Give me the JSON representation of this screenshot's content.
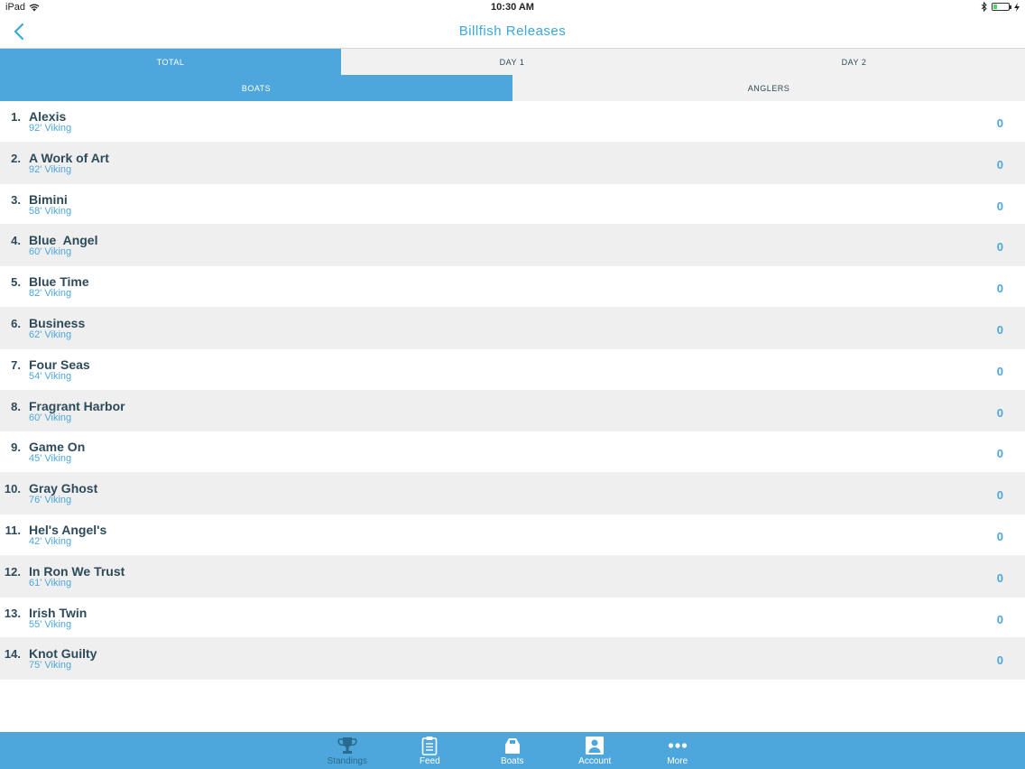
{
  "status_bar": {
    "device": "iPad",
    "time": "10:30 AM"
  },
  "nav": {
    "title": "Billfish Releases"
  },
  "day_tabs": [
    {
      "label": "TOTAL",
      "active": true
    },
    {
      "label": "DAY 1",
      "active": false
    },
    {
      "label": "DAY 2",
      "active": false
    }
  ],
  "kind_tabs": [
    {
      "label": "BOATS",
      "active": true
    },
    {
      "label": "ANGLERS",
      "active": false
    }
  ],
  "rows": [
    {
      "rank": "1.",
      "name": "Alexis",
      "sub": "92' Viking",
      "score": "0"
    },
    {
      "rank": "2.",
      "name": "A Work of Art",
      "sub": "92' Viking",
      "score": "0"
    },
    {
      "rank": "3.",
      "name": "Bimini",
      "sub": "58' Viking",
      "score": "0"
    },
    {
      "rank": "4.",
      "name": "Blue  Angel",
      "sub": "60' Viking",
      "score": "0"
    },
    {
      "rank": "5.",
      "name": "Blue Time",
      "sub": "82' Viking",
      "score": "0"
    },
    {
      "rank": "6.",
      "name": "Business",
      "sub": "62' Viking",
      "score": "0"
    },
    {
      "rank": "7.",
      "name": "Four Seas",
      "sub": "54' Viking",
      "score": "0"
    },
    {
      "rank": "8.",
      "name": "Fragrant Harbor",
      "sub": "60' Viking",
      "score": "0"
    },
    {
      "rank": "9.",
      "name": "Game On",
      "sub": "45' Viking",
      "score": "0"
    },
    {
      "rank": "10.",
      "name": "Gray Ghost",
      "sub": "76' Viking",
      "score": "0"
    },
    {
      "rank": "11.",
      "name": "Hel's Angel's",
      "sub": "42' Viking",
      "score": "0"
    },
    {
      "rank": "12.",
      "name": "In Ron We Trust",
      "sub": "61' Viking",
      "score": "0"
    },
    {
      "rank": "13.",
      "name": "Irish Twin",
      "sub": "55' Viking",
      "score": "0"
    },
    {
      "rank": "14.",
      "name": "Knot Guilty",
      "sub": "75' Viking",
      "score": "0"
    }
  ],
  "tab_bar": [
    {
      "label": "Standings",
      "icon": "trophy-icon",
      "selected": true
    },
    {
      "label": "Feed",
      "icon": "clipboard-icon",
      "selected": false
    },
    {
      "label": "Boats",
      "icon": "boat-icon",
      "selected": false
    },
    {
      "label": "Account",
      "icon": "person-icon",
      "selected": false
    },
    {
      "label": "More",
      "icon": "more-dots-icon",
      "selected": false
    }
  ],
  "colors": {
    "accent": "#4da7dc",
    "title": "#3aa8d8",
    "text_dark": "#2d4a5a",
    "row_alt": "#efefef"
  }
}
